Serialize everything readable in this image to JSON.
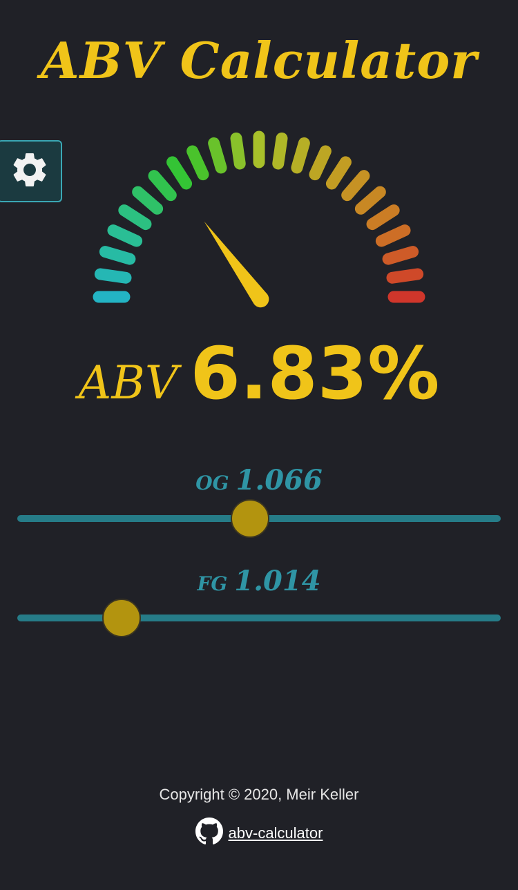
{
  "app": {
    "title": "ABV Calculator"
  },
  "settings": {
    "icon": "gear-icon"
  },
  "gauge": {
    "value_fraction": 0.3,
    "segment_count": 23,
    "colors": [
      "#23b4c4",
      "#2bc08a",
      "#35c42c",
      "#a8c02a",
      "#c2a023",
      "#cc7a25",
      "#d0362b"
    ],
    "needle_color": "#f0c419"
  },
  "abv": {
    "label": "ABV",
    "value": "6.83%"
  },
  "og": {
    "label": "OG",
    "value": "1.066",
    "slider_fraction": 0.482
  },
  "fg": {
    "label": "FG",
    "value": "1.014",
    "slider_fraction": 0.216
  },
  "footer": {
    "copyright": "Copyright © 2020, Meir Keller",
    "repo_icon": "github-icon",
    "repo_link": "abv-calculator"
  },
  "colors": {
    "background": "#202127",
    "accent": "#f0c419",
    "slider": "#267c88",
    "thumb": "#b3940f"
  }
}
